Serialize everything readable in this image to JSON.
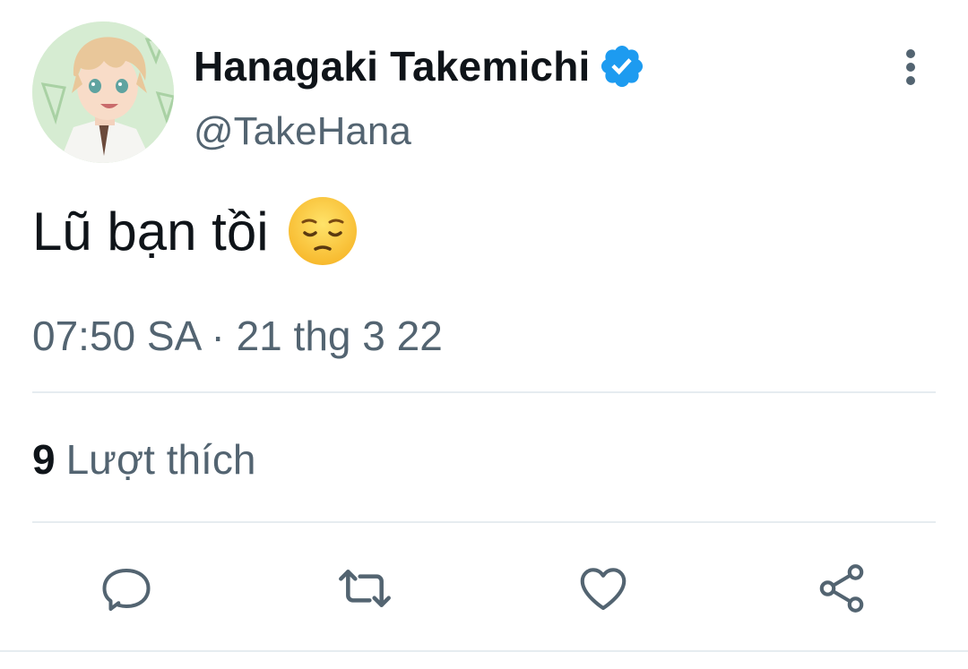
{
  "author": {
    "display_name": "Hanagaki Takemichi",
    "handle": "@TakeHana",
    "verified": true,
    "avatar_icon": "avatar-anime-boy"
  },
  "tweet": {
    "text": "Lũ bạn tồi",
    "emoji": "pensive-face-emoji",
    "timestamp": "07:50 SA · 21 thg 3 22"
  },
  "stats": {
    "likes_count": "9",
    "likes_label": "Lượt thích"
  },
  "actions": {
    "reply_icon": "reply-icon",
    "retweet_icon": "retweet-icon",
    "like_icon": "heart-icon",
    "share_icon": "share-icon",
    "more_icon": "more-vertical-icon"
  },
  "colors": {
    "primary_text": "#0f1419",
    "secondary_text": "#536471",
    "verified_blue": "#1d9bf0",
    "divider": "#e6ecf0"
  }
}
